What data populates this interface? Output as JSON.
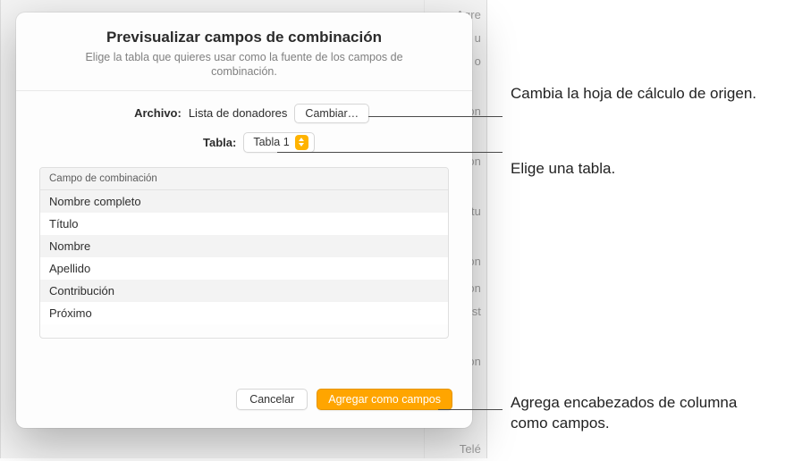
{
  "dialog": {
    "title": "Previsualizar campos de combinación",
    "subtitle": "Elige la tabla que quieres usar como la fuente de los campos de combinación.",
    "file_label": "Archivo:",
    "file_value": "Lista de donadores",
    "change_button": "Cambiar…",
    "table_label": "Tabla:",
    "table_value": "Tabla 1",
    "column_header": "Campo de combinación",
    "rows": [
      "Nombre completo",
      "Título",
      "Nombre",
      "Apellido",
      "Contribución",
      "Próximo"
    ],
    "cancel_button": "Cancelar",
    "add_button": "Agregar como campos"
  },
  "callouts": {
    "change_source": "Cambia la hoja de cálculo de origen.",
    "choose_table": "Elige una tabla.",
    "add_headers": "Agrega encabezados de columna como campos."
  },
  "backdrop": {
    "fragments": [
      "Agre",
      "u",
      "o",
      "on",
      "on",
      "tu",
      "on",
      "on",
      "st",
      "on",
      "Telé"
    ]
  }
}
